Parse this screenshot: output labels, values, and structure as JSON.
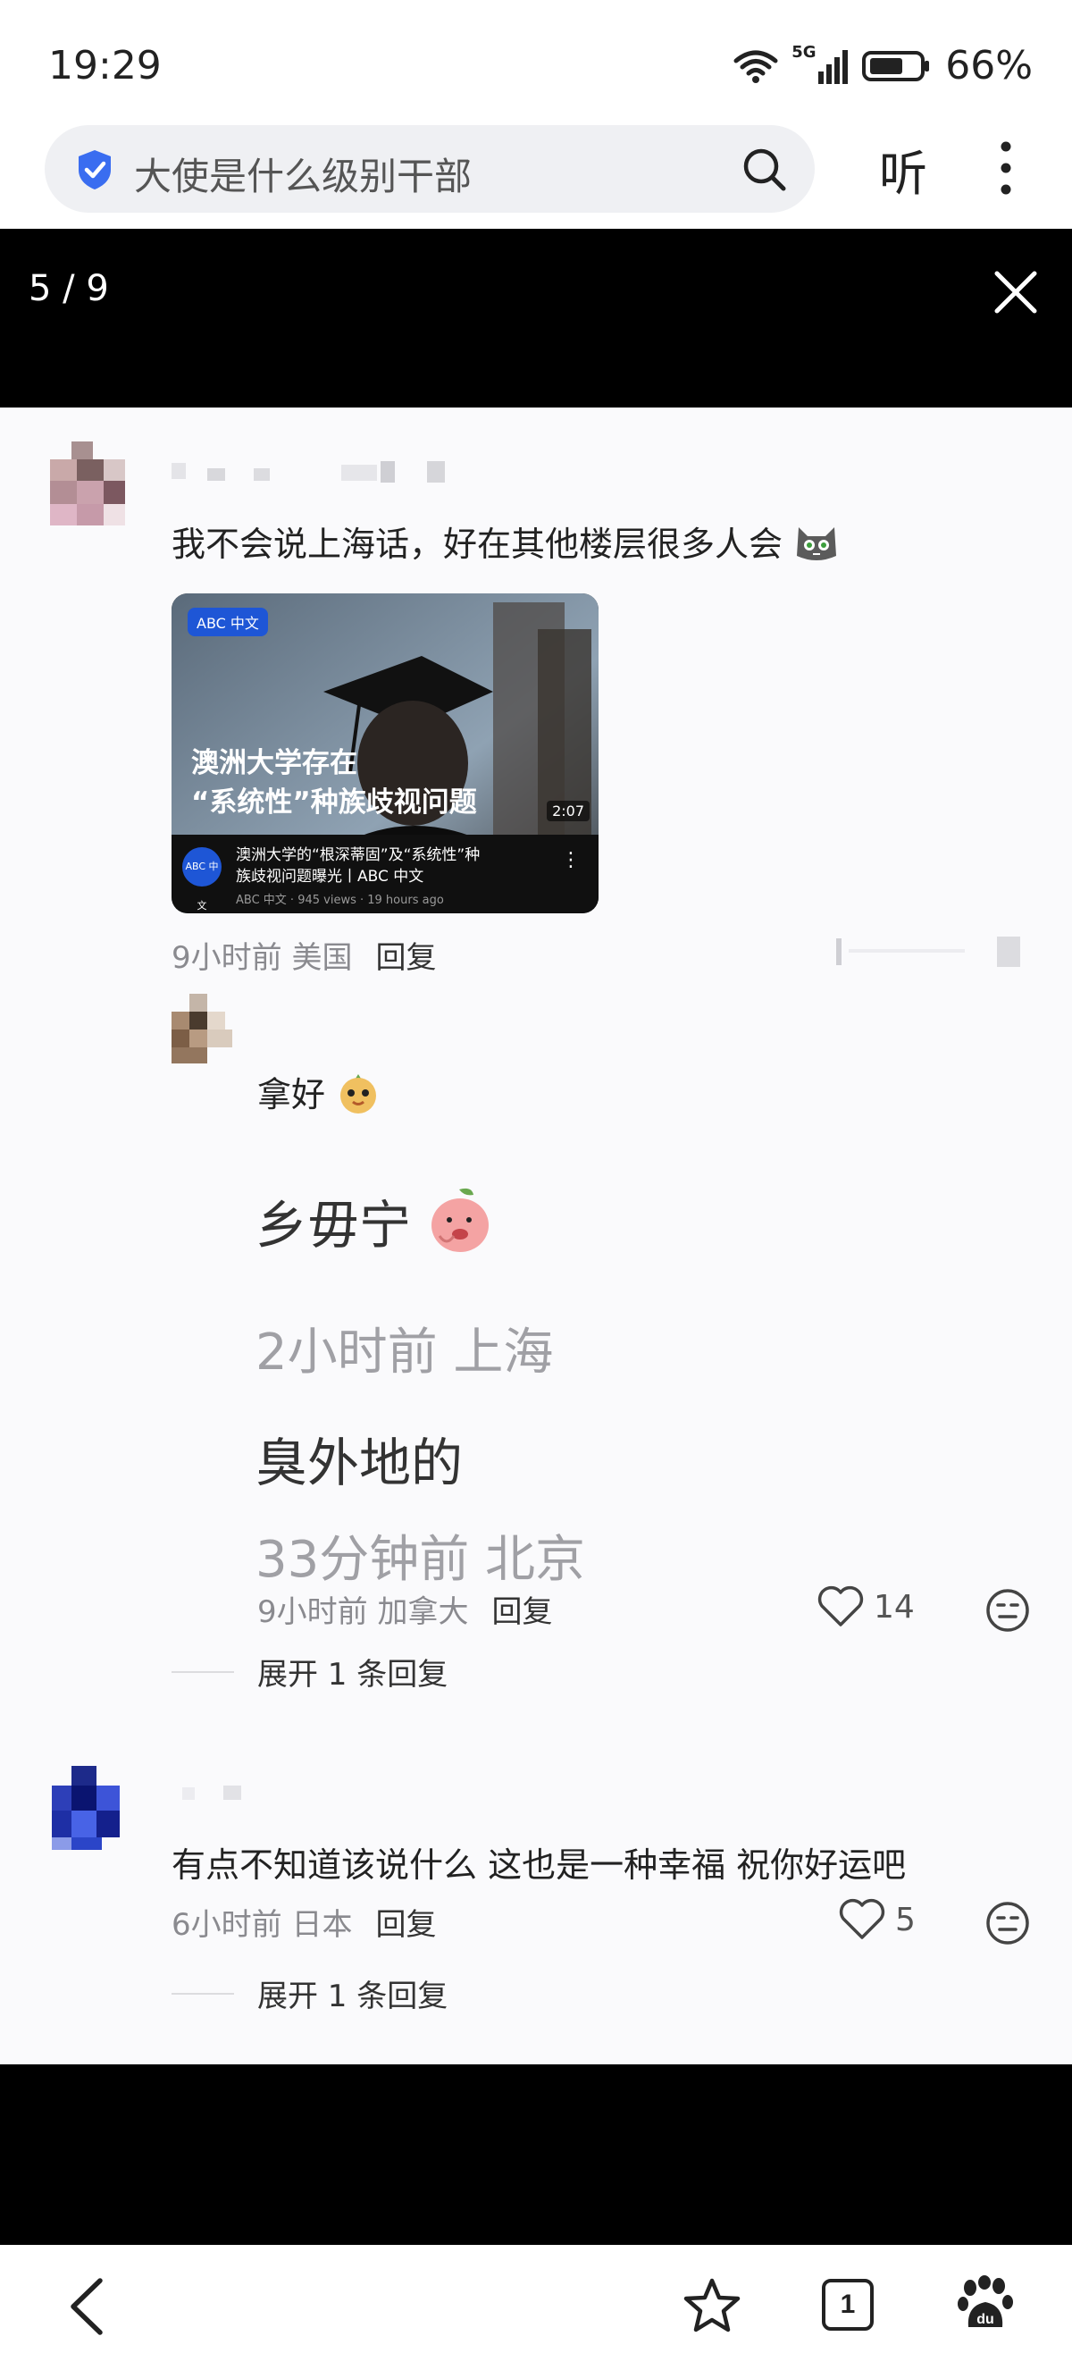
{
  "status_bar": {
    "time": "19:29",
    "network": "5G",
    "battery": "66%"
  },
  "search": {
    "query": "大使是什么级别干部"
  },
  "header": {
    "listen_label": "听"
  },
  "viewer": {
    "counter": "5 / 9"
  },
  "comments": [
    {
      "text": "我不会说上海话，好在其他楼层很多人会",
      "video": {
        "badge": "ABC 中文",
        "title_line1": "澳洲大学存在",
        "title_line2": "“系统性”种族歧视问题",
        "duration": "2:07",
        "channel_logo": "ABC 中文",
        "caption_line1": "澳洲大学的“根深蒂固”及“系统性”种",
        "caption_line2": "族歧视问题曝光丨ABC 中文",
        "views": "ABC 中文 · 945 views · 19 hours ago"
      },
      "meta": "9小时前 美国",
      "reply": "回复"
    },
    {
      "text": "拿好",
      "quote": [
        {
          "text": "乡毋宁",
          "meta": "2小时前 上海"
        },
        {
          "text": "臭外地的",
          "meta": "33分钟前 北京"
        }
      ],
      "meta": "9小时前 加拿大",
      "reply": "回复",
      "likes": "14",
      "expand": "展开 1 条回复"
    },
    {
      "text": "有点不知道该说什么 这也是一种幸福 祝你好运吧",
      "meta": "6小时前 日本",
      "reply": "回复",
      "likes": "5",
      "expand": "展开 1 条回复"
    }
  ],
  "bottom_nav": {
    "tab_count": "1"
  },
  "colors": {
    "accent": "#3a6df0",
    "panel_bg": "#fafafc",
    "meta_gray": "#8a8a8f"
  }
}
